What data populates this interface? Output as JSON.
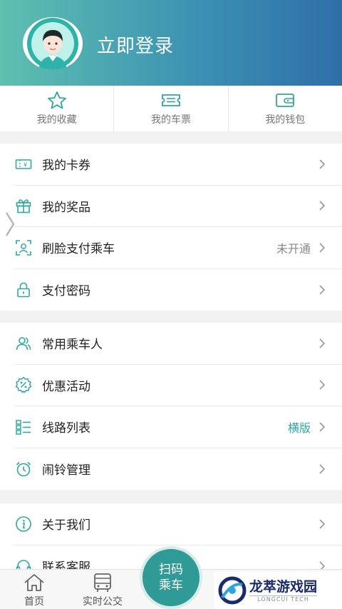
{
  "header": {
    "login_label": "立即登录"
  },
  "quick": [
    {
      "label": "我的收藏",
      "icon": "star-icon"
    },
    {
      "label": "我的车票",
      "icon": "ticket-icon"
    },
    {
      "label": "我的钱包",
      "icon": "wallet-icon"
    }
  ],
  "group1": [
    {
      "label": "我的卡券",
      "icon": "coupon-icon",
      "status": ""
    },
    {
      "label": "我的奖品",
      "icon": "gift-icon",
      "status": ""
    },
    {
      "label": "刷脸支付乘车",
      "icon": "face-scan-icon",
      "status": "未开通"
    },
    {
      "label": "支付密码",
      "icon": "lock-icon",
      "status": ""
    }
  ],
  "group2": [
    {
      "label": "常用乘车人",
      "icon": "users-icon",
      "status": ""
    },
    {
      "label": "优惠活动",
      "icon": "discount-icon",
      "status": ""
    },
    {
      "label": "线路列表",
      "icon": "list-icon",
      "status": "横版"
    },
    {
      "label": "闹铃管理",
      "icon": "alarm-icon",
      "status": ""
    }
  ],
  "group3": [
    {
      "label": "关于我们",
      "icon": "info-icon",
      "status": ""
    },
    {
      "label": "联系客服",
      "icon": "headset-icon",
      "status": ""
    }
  ],
  "tabs": [
    {
      "label": "首页",
      "icon": "home-icon"
    },
    {
      "label": "实时公交",
      "icon": "bus-icon"
    }
  ],
  "scan": {
    "line1": "扫码",
    "line2": "乘车"
  },
  "watermark": {
    "cn": "龙萃游戏园",
    "en": "LONGCUI TECH"
  },
  "colors": {
    "accent": "#2fa6a0",
    "header_start": "#5ec0b0",
    "header_end": "#2f6fa8"
  }
}
